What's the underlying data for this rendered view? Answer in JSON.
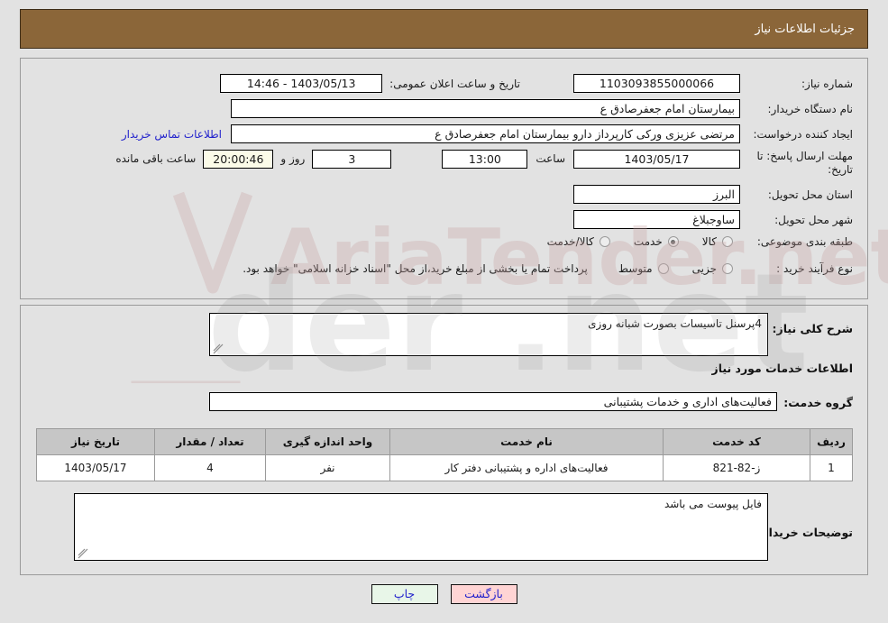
{
  "header": {
    "title": "جزئیات اطلاعات نیاز"
  },
  "form": {
    "need_number_label": "شماره نیاز:",
    "need_number_value": "1103093855000066",
    "public_announce_label": "تاریخ و ساعت اعلان عمومی:",
    "public_announce_value": "1403/05/13 - 14:46",
    "buyer_org_label": "نام دستگاه خریدار:",
    "buyer_org_value": "بیمارستان امام جعفرصادق ع",
    "creator_label": "ایجاد کننده درخواست:",
    "creator_value": "مرتضی عزیزی ورکی کارپرداز دارو بیمارستان امام جعفرصادق ع",
    "contact_link": "اطلاعات تماس خریدار",
    "deadline_label": "مهلت ارسال پاسخ: تا تاریخ:",
    "deadline_date": "1403/05/17",
    "hour_label": "ساعت",
    "deadline_time": "13:00",
    "days_remaining": "3",
    "days_and_label": "روز و",
    "countdown": "20:00:46",
    "remaining_label": "ساعت باقی مانده",
    "province_label": "استان محل تحویل:",
    "province_value": "البرز",
    "city_label": "شهر محل تحویل:",
    "city_value": "ساوجبلاغ",
    "category_label": "طبقه بندی موضوعی:",
    "category_options": [
      {
        "label": "کالا",
        "selected": false
      },
      {
        "label": "خدمت",
        "selected": true
      },
      {
        "label": "کالا/خدمت",
        "selected": false
      }
    ],
    "purchase_type_label": "نوع فرآیند خرید :",
    "purchase_type_options": [
      {
        "label": "جزیی",
        "selected": false
      },
      {
        "label": "متوسط",
        "selected": false
      }
    ],
    "treasury_note": "پرداخت تمام یا بخشی از مبلغ خرید،از محل \"اسناد خزانه اسلامی\" خواهد بود."
  },
  "details": {
    "summary_label": "شرح کلی نیاز:",
    "summary_value": "4پرسنل تاسیسات بصورت شبانه روزی",
    "section_title": "اطلاعات خدمات مورد نیاز",
    "service_group_label": "گروه خدمت:",
    "service_group_value": "فعالیت‌های اداری و خدمات پشتیبانی",
    "buyer_notes_label": "توضیحات خریدار:",
    "buyer_notes_value": "فایل پیوست می باشد"
  },
  "table": {
    "columns": [
      "ردیف",
      "کد خدمت",
      "نام خدمت",
      "واحد اندازه گیری",
      "تعداد / مقدار",
      "تاریخ نیاز"
    ],
    "rows": [
      {
        "index": "1",
        "service_code": "ز-82-821",
        "service_name": "فعالیت‌های اداره و پشتیبانی دفتر کار",
        "unit": "نفر",
        "quantity": "4",
        "need_date": "1403/05/17"
      }
    ]
  },
  "buttons": {
    "print": "چاپ",
    "back": "بازگشت"
  }
}
